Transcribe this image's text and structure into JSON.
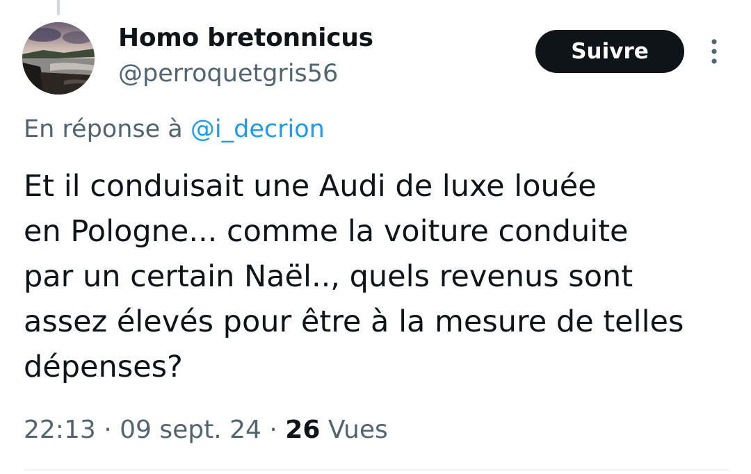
{
  "tweet": {
    "author": {
      "display_name": "Homo bretonnicus",
      "handle": "@perroquetgris56",
      "avatar_icon": "landscape-avatar"
    },
    "follow_label": "Suivre",
    "more_icon": "more-vertical-icon",
    "reply_prefix": "En réponse à",
    "reply_to": "@i_decrion",
    "text_lines": [
      "Et il conduisait une Audi de luxe louée",
      "en Pologne... comme la voiture conduite",
      "par un certain Naël.., quels revenus sont",
      "assez élevés pour être à la mesure de telles",
      "dépenses?"
    ],
    "time": "22:13",
    "separator": "·",
    "date": "09 sept. 24",
    "views_count": "26",
    "views_label": "Vues"
  },
  "colors": {
    "text_primary": "#0f1419",
    "text_secondary": "#536471",
    "link": "#1d9bf0",
    "button_bg": "#0f1419",
    "button_text": "#ffffff"
  }
}
